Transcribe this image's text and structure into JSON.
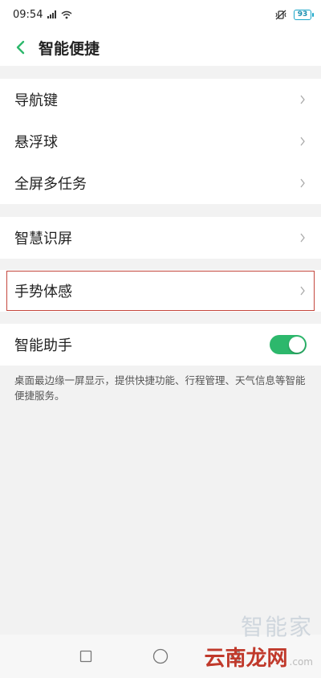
{
  "status": {
    "time": "09:54",
    "battery": "93"
  },
  "header": {
    "title": "智能便捷"
  },
  "groups": [
    {
      "items": [
        {
          "label": "导航键"
        },
        {
          "label": "悬浮球"
        },
        {
          "label": "全屏多任务"
        }
      ]
    },
    {
      "items": [
        {
          "label": "智慧识屏"
        }
      ]
    },
    {
      "items": [
        {
          "label": "手势体感"
        }
      ]
    }
  ],
  "assistant": {
    "label": "智能助手",
    "enabled": true,
    "description": "桌面最边缘一屏显示，提供快捷功能、行程管理、天气信息等智能便捷服务。"
  },
  "watermark": {
    "top": "智能家",
    "bottom": "云南龙网",
    "com": ".com"
  },
  "colors": {
    "accent": "#2db86c",
    "highlight_border": "#c4473e",
    "back_arrow": "#2db86c"
  }
}
